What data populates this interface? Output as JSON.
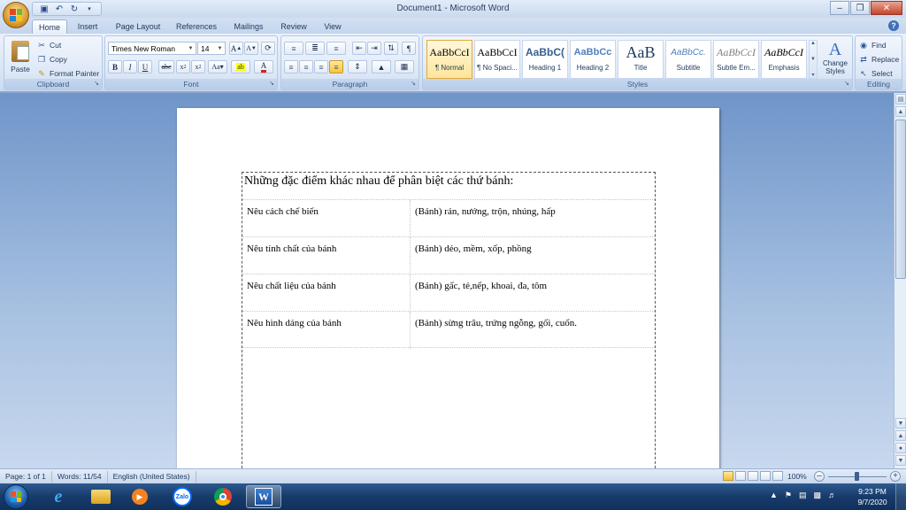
{
  "window": {
    "title": "Document1 - Microsoft Word"
  },
  "tabs": [
    "Home",
    "Insert",
    "Page Layout",
    "References",
    "Mailings",
    "Review",
    "View"
  ],
  "clipboard": {
    "paste_label": "Paste",
    "cut_label": "Cut",
    "copy_label": "Copy",
    "format_painter_label": "Format Painter",
    "group_label": "Clipboard"
  },
  "font": {
    "family": "Times New Roman",
    "size": "14",
    "group_label": "Font"
  },
  "paragraph": {
    "group_label": "Paragraph"
  },
  "styles": {
    "group_label": "Styles",
    "items": [
      {
        "sample": "AaBbCcI",
        "name": "¶ Normal"
      },
      {
        "sample": "AaBbCcI",
        "name": "¶ No Spaci..."
      },
      {
        "sample": "AaBbC(",
        "name": "Heading 1"
      },
      {
        "sample": "AaBbCc",
        "name": "Heading 2"
      },
      {
        "sample": "AaB",
        "name": "Title"
      },
      {
        "sample": "AaBbCc.",
        "name": "Subtitle"
      },
      {
        "sample": "AaBbCcI",
        "name": "Subtle Em..."
      },
      {
        "sample": "AaBbCcI",
        "name": "Emphasis"
      }
    ],
    "change_styles_label": "Change Styles"
  },
  "editing": {
    "group_label": "Editing",
    "find_label": "Find",
    "replace_label": "Replace",
    "select_label": "Select"
  },
  "document": {
    "title": "Những đặc điểm khác nhau để phân biệt các thứ bánh:",
    "rows": [
      {
        "left": "Nêu cách chế biến",
        "right": "(Bánh) rán, nướng, trộn, nhúng, hấp"
      },
      {
        "left": "Nêu tính chất của bánh",
        "right": "(Bánh) dẻo, mềm, xốp, phồng"
      },
      {
        "left": "Nêu chất liệu của bánh",
        "right": "(Bánh) gấc, tẻ,nếp, khoai, đa, tôm"
      },
      {
        "left": "Nêu hình dáng của bánh",
        "right": "(Bánh) sừng trâu, trứng ngỗng, gối, cuốn."
      }
    ]
  },
  "status": {
    "page": "Page: 1 of 1",
    "words": "Words: 11/54",
    "language": "English (United States)",
    "zoom": "100%"
  },
  "taskbar": {
    "zalo_label": "Zalo",
    "time": "9:23 PM",
    "date": "9/7/2020"
  },
  "colors": {
    "ribbon_bg": "#d7e4f5",
    "doc_bg": "#8aa8cf",
    "taskbar_bg": "#173b6a"
  }
}
